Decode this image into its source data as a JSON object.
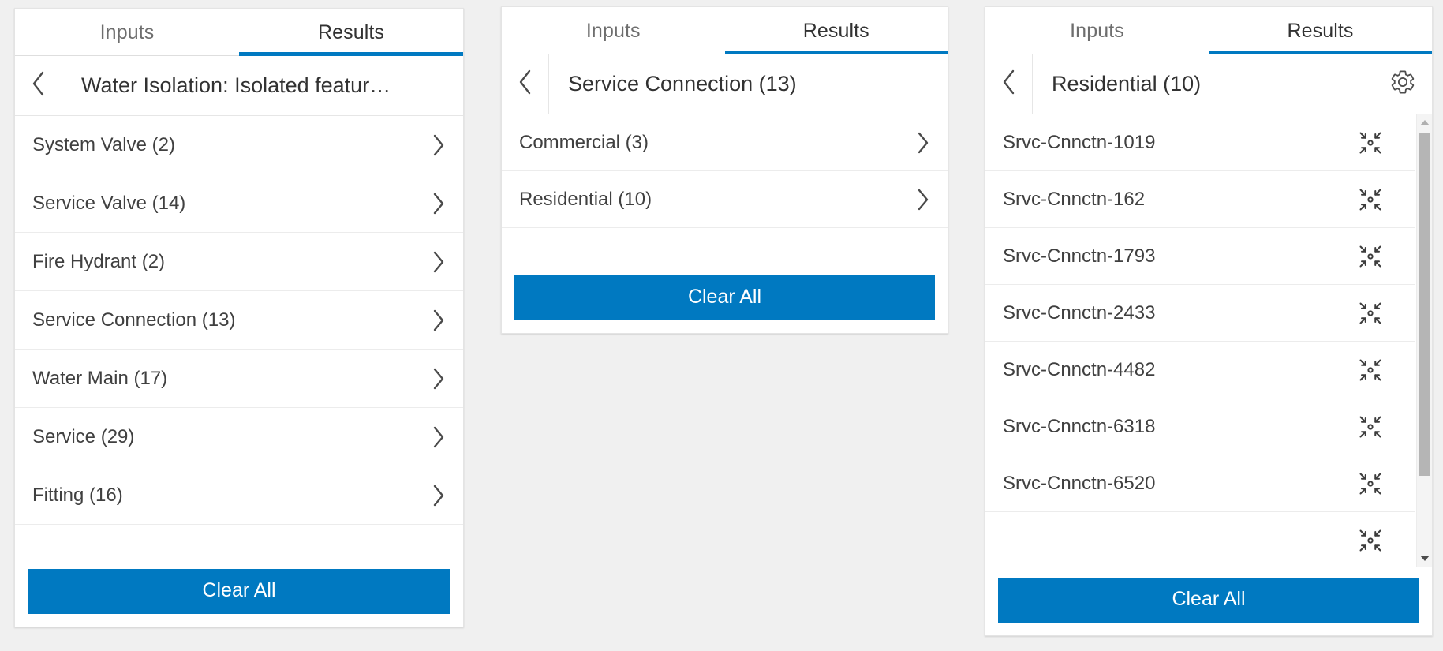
{
  "theme": {
    "accent_blue": "#0079c1",
    "text_dark": "#323232",
    "text_muted": "#6e6e6e",
    "panel_bg": "#ffffff",
    "page_bg": "#f0f0f0"
  },
  "panels": [
    {
      "id": "water-isolation",
      "tabs": [
        {
          "label": "Inputs",
          "active": false
        },
        {
          "label": "Results",
          "active": true
        }
      ],
      "back_icon": "chevron-left-icon",
      "title": "Water Isolation: Isolated featur…",
      "has_gear": false,
      "rows": [
        {
          "label": "System Valve (2)",
          "trailing": "chevron-right-icon"
        },
        {
          "label": "Service Valve (14)",
          "trailing": "chevron-right-icon"
        },
        {
          "label": "Fire Hydrant (2)",
          "trailing": "chevron-right-icon"
        },
        {
          "label": "Service Connection (13)",
          "trailing": "chevron-right-icon"
        },
        {
          "label": "Water Main (17)",
          "trailing": "chevron-right-icon"
        },
        {
          "label": "Service (29)",
          "trailing": "chevron-right-icon"
        },
        {
          "label": "Fitting (16)",
          "trailing": "chevron-right-icon"
        }
      ],
      "clear_all_label": "Clear All",
      "scrollbar": null
    },
    {
      "id": "service-connection",
      "tabs": [
        {
          "label": "Inputs",
          "active": false
        },
        {
          "label": "Results",
          "active": true
        }
      ],
      "back_icon": "chevron-left-icon",
      "title": "Service Connection (13)",
      "has_gear": false,
      "rows": [
        {
          "label": "Commercial (3)",
          "trailing": "chevron-right-icon"
        },
        {
          "label": "Residential (10)",
          "trailing": "chevron-right-icon"
        }
      ],
      "clear_all_label": "Clear All",
      "scrollbar": null
    },
    {
      "id": "residential",
      "tabs": [
        {
          "label": "Inputs",
          "active": false
        },
        {
          "label": "Results",
          "active": true
        }
      ],
      "back_icon": "chevron-left-icon",
      "title": "Residential (10)",
      "has_gear": true,
      "gear_icon": "gear-icon",
      "rows": [
        {
          "label": "Srvc-Cnnctn-1019",
          "trailing": "zoom-to-icon"
        },
        {
          "label": "Srvc-Cnnctn-162",
          "trailing": "zoom-to-icon"
        },
        {
          "label": "Srvc-Cnnctn-1793",
          "trailing": "zoom-to-icon"
        },
        {
          "label": "Srvc-Cnnctn-2433",
          "trailing": "zoom-to-icon"
        },
        {
          "label": "Srvc-Cnnctn-4482",
          "trailing": "zoom-to-icon"
        },
        {
          "label": "Srvc-Cnnctn-6318",
          "trailing": "zoom-to-icon"
        },
        {
          "label": "Srvc-Cnnctn-6520",
          "trailing": "zoom-to-icon"
        },
        {
          "label": "",
          "trailing": "zoom-to-icon"
        }
      ],
      "clear_all_label": "Clear All",
      "scrollbar": {
        "up_arrow_icon": "caret-up-icon",
        "down_arrow_icon": "caret-down-icon",
        "thumb_top_pct": 4,
        "thumb_height_pct": 76
      }
    }
  ]
}
